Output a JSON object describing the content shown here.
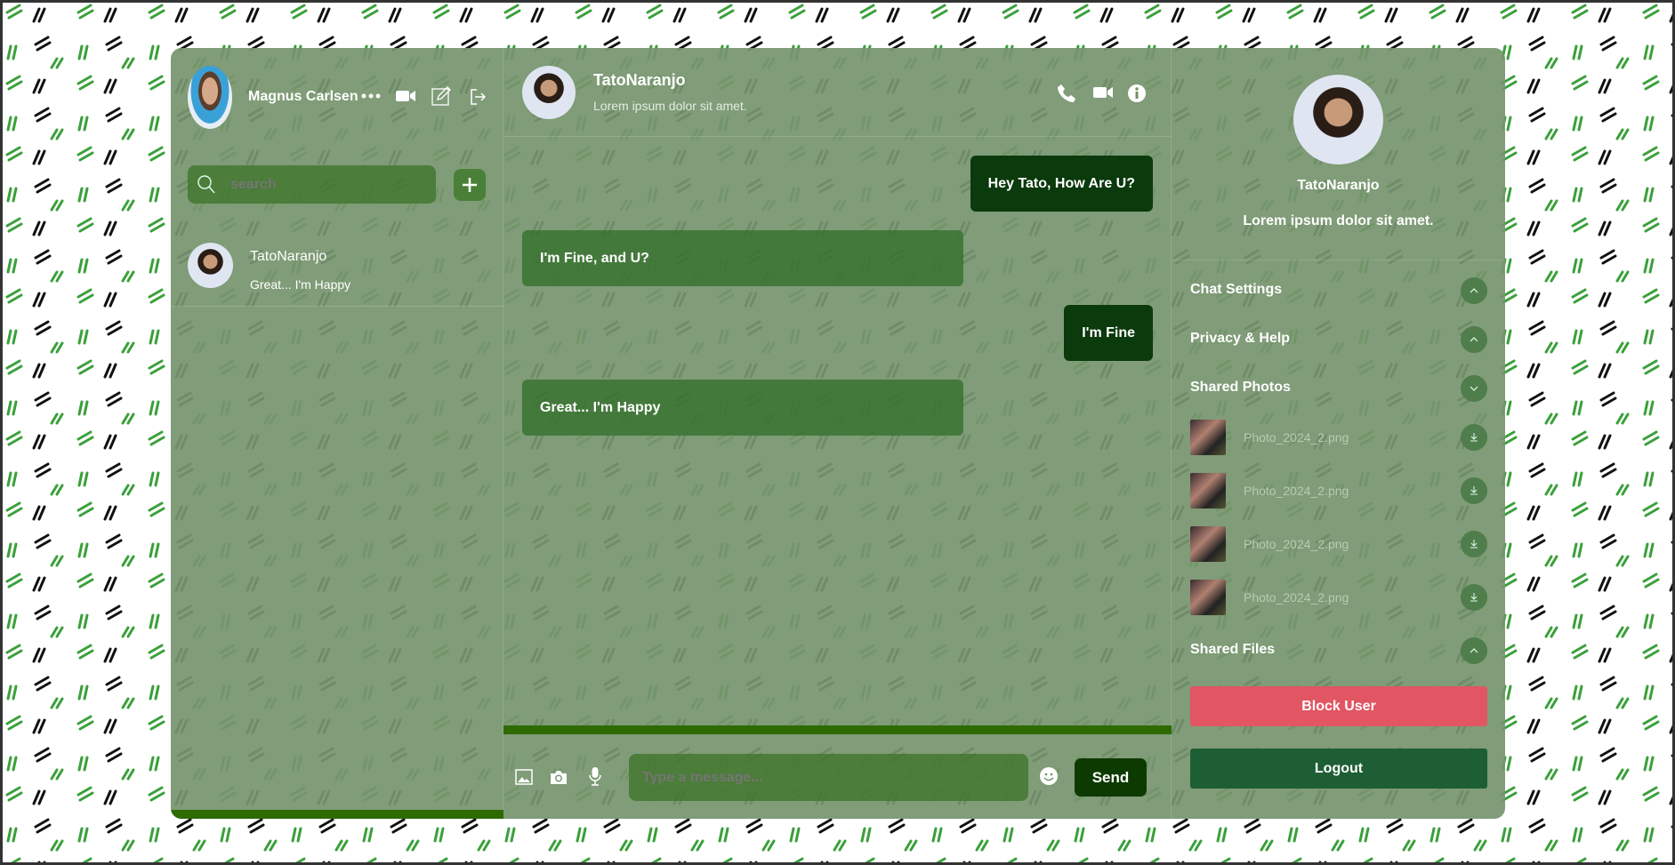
{
  "colors": {
    "accent": "#2d6a00",
    "outgoing": "#0b3a0c",
    "block": "#e25563",
    "logout": "#1e5e34"
  },
  "user": {
    "name": "Magnus Carlsen"
  },
  "search": {
    "placeholder": "search"
  },
  "contacts": [
    {
      "name": "TatoNaranjo",
      "last_message": "Great... I'm Happy"
    }
  ],
  "chat": {
    "name": "TatoNaranjo",
    "status": "Lorem ipsum dolor sit amet.",
    "messages": [
      {
        "from": "me",
        "text": "Hey Tato, How Are U?"
      },
      {
        "from": "them",
        "text": "I'm Fine, and U?"
      },
      {
        "from": "me",
        "text": "I'm Fine"
      },
      {
        "from": "them",
        "text": "Great... I'm Happy"
      }
    ],
    "input_placeholder": "Type a message...",
    "send_label": "Send"
  },
  "details": {
    "name": "TatoNaranjo",
    "bio": "Lorem ipsum dolor sit amet.",
    "sections": {
      "chat_settings": "Chat Settings",
      "privacy": "Privacy & Help",
      "shared_photos": "Shared Photos",
      "shared_files": "Shared Files"
    },
    "photos": [
      "Photo_2024_2.png",
      "Photo_2024_2.png",
      "Photo_2024_2.png",
      "Photo_2024_2.png"
    ],
    "block_label": "Block User",
    "logout_label": "Logout"
  }
}
